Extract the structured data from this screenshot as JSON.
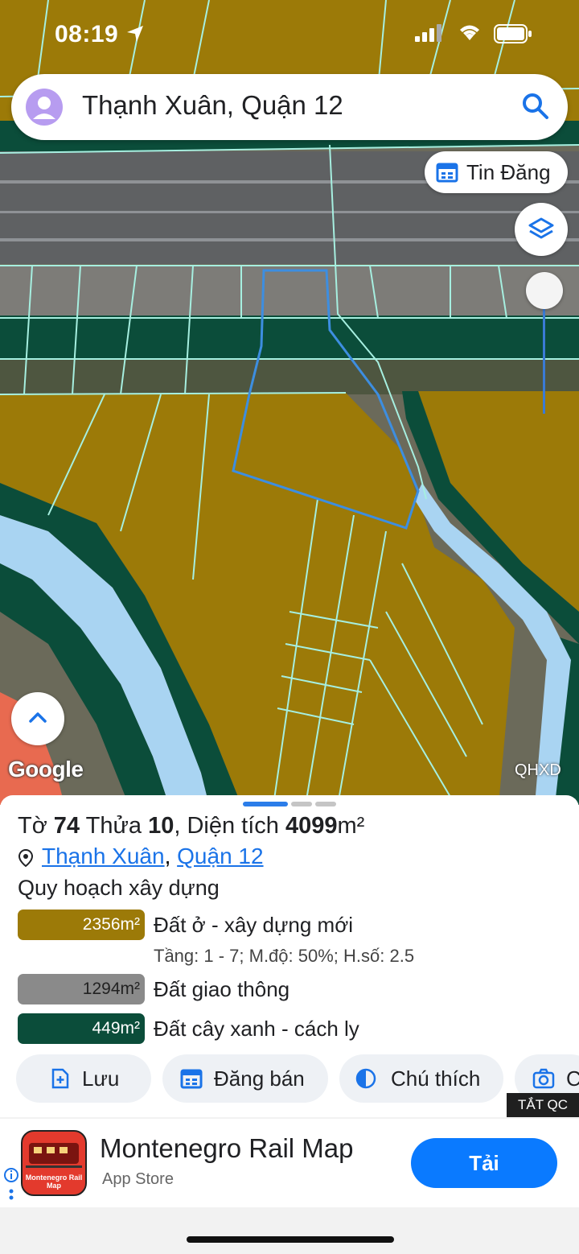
{
  "status_bar": {
    "time": "08:19"
  },
  "search": {
    "text": "Thạnh Xuân, Quận 12",
    "icon": "search-icon"
  },
  "map_controls": {
    "tin_dang_label": "Tin Đăng",
    "layers_icon": "layers-icon",
    "google_label": "Google",
    "qhxd_label": "QHXD"
  },
  "colors": {
    "residential": "#9c7a08",
    "road": "#8a8a8a",
    "green": "#0b4d3a",
    "water": "#a9d4f2",
    "parcel_outline": "#a6efe0",
    "selected_outline": "#3d8ee0",
    "accent": "#1a73e8"
  },
  "parcel": {
    "prefix_to": "Tờ",
    "to": "74",
    "prefix_thua": "Thửa",
    "thua": "10",
    "prefix_area": ", Diện tích",
    "area": "4099",
    "unit": "m²"
  },
  "address": {
    "ward": "Thạnh Xuân",
    "separator": ",",
    "district": "Quận 12"
  },
  "planning": {
    "title": "Quy hoạch xây dựng",
    "zones": [
      {
        "area": "2356m²",
        "label": "Đất ở - xây dựng mới",
        "detail": "Tầng: 1 - 7; M.độ: 50%; H.số: 2.5",
        "color": "#9c7a08"
      },
      {
        "area": "1294m²",
        "label": "Đất giao thông",
        "color": "#8a8a8a"
      },
      {
        "area": "449m²",
        "label": "Đất cây xanh - cách ly",
        "color": "#0b4d3a"
      }
    ]
  },
  "actions": [
    {
      "label": "Lưu",
      "icon": "save-icon"
    },
    {
      "label": "Đăng bán",
      "icon": "calendar-icon"
    },
    {
      "label": "Chú thích",
      "icon": "legend-icon"
    },
    {
      "label": "C",
      "icon": "camera-icon"
    }
  ],
  "ad": {
    "close_label": "TẮT QC",
    "title": "Montenegro Rail Map",
    "store": "App Store",
    "button": "Tải",
    "icon_text": "Montenegro Rail Map"
  }
}
